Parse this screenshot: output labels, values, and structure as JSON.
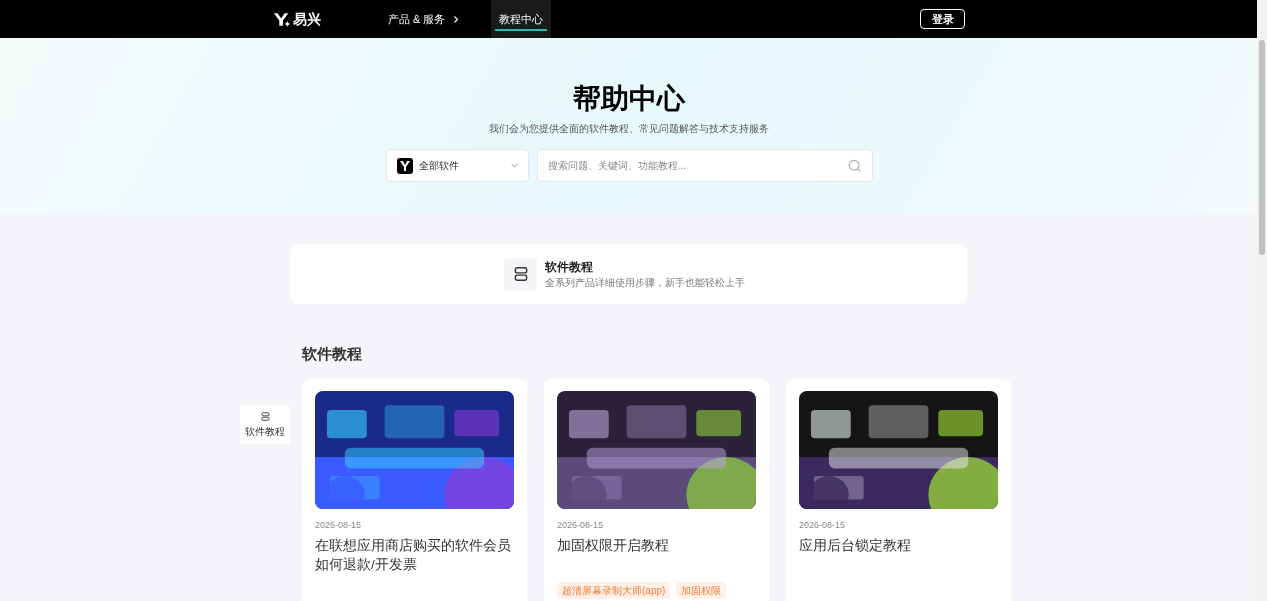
{
  "nav": {
    "logo_text": "易兴",
    "items": [
      {
        "label": "产品 & 服务",
        "selected": false,
        "has_caret": true
      },
      {
        "label": "教程中心",
        "selected": true,
        "has_caret": false
      }
    ],
    "login": "登录"
  },
  "hero": {
    "title": "帮助中心",
    "subtitle": "我们会为您提供全面的软件教程、常见问题解答与技术支持服务",
    "select": {
      "value": "全部软件"
    },
    "search": {
      "placeholder": "搜索问题、关键词、功能教程..."
    }
  },
  "category": {
    "title": "软件教程",
    "description": "全系列产品详细使用步骤，新手也能轻松上手"
  },
  "side_nav": {
    "label": "软件教程"
  },
  "section": {
    "title": "软件教程",
    "articles": [
      {
        "date": "2026-08-15",
        "title": "在联想应用商店购买的软件会员如何退款/开发票",
        "picture": {
          "kind": "picture"
        }
      },
      {
        "date": "2026-08-15",
        "title": "加固权限开启教程",
        "tags": [
          "超清屏幕录制大师(app)",
          "加固权限"
        ],
        "picture": {
          "kind": "picture"
        }
      },
      {
        "date": "2026-08-15",
        "title": "应用后台锁定教程",
        "picture": {
          "kind": "picture"
        }
      }
    ]
  }
}
